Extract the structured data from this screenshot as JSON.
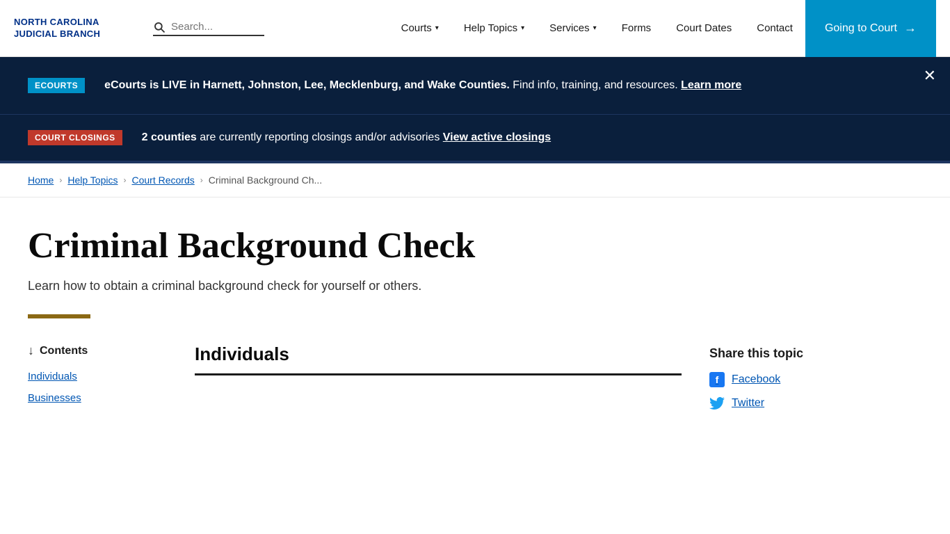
{
  "site": {
    "name_line1": "NORTH CAROLINA",
    "name_line2": "JUDICIAL BRANCH"
  },
  "header": {
    "search_placeholder": "Search...",
    "nav": [
      {
        "label": "Courts",
        "hasDropdown": true
      },
      {
        "label": "Help Topics",
        "hasDropdown": true
      },
      {
        "label": "Services",
        "hasDropdown": true
      },
      {
        "label": "Forms",
        "hasDropdown": false
      },
      {
        "label": "Court Dates",
        "hasDropdown": false
      },
      {
        "label": "Contact",
        "hasDropdown": false
      }
    ],
    "cta_label": "Going to Court"
  },
  "banners": {
    "ecourts": {
      "badge": "ECOURTS",
      "text_bold": "eCourts is LIVE in Harnett, Johnston, Lee, Mecklenburg, and Wake Counties.",
      "text_normal": " Find info, training, and resources.",
      "link_label": "Learn more"
    },
    "closings": {
      "badge": "COURT CLOSINGS",
      "count_bold": "2 counties",
      "text_normal": " are currently reporting closings and/or advisories",
      "link_label": "View active closings"
    }
  },
  "breadcrumb": {
    "items": [
      {
        "label": "Home",
        "link": true
      },
      {
        "label": "Help Topics",
        "link": true
      },
      {
        "label": "Court Records",
        "link": true
      },
      {
        "label": "Criminal Background Ch...",
        "link": false
      }
    ]
  },
  "page": {
    "title": "Criminal Background Check",
    "subtitle": "Learn how to obtain a criminal background check for yourself or others."
  },
  "contents": {
    "heading": "Contents",
    "links": [
      {
        "label": "Individuals"
      },
      {
        "label": "Businesses"
      }
    ]
  },
  "article": {
    "section_title": "Individuals"
  },
  "share": {
    "title": "Share this topic",
    "facebook_label": "Facebook",
    "twitter_label": "Twitter"
  }
}
